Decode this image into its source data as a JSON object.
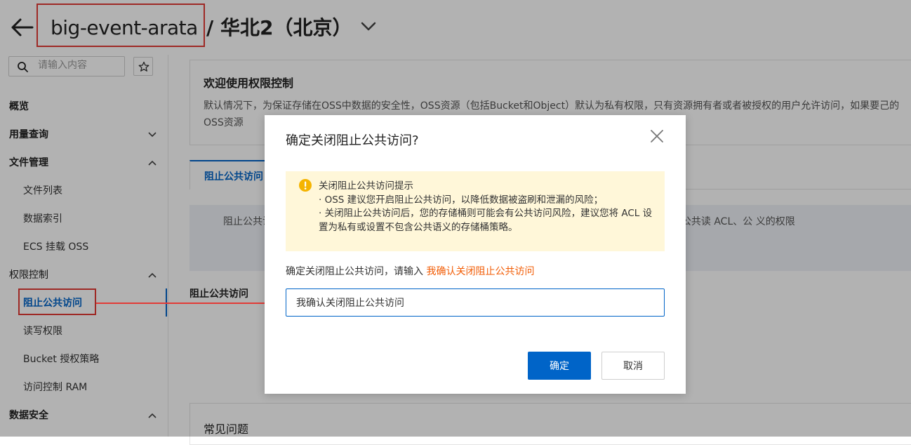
{
  "header": {
    "bucket_name": "big-event-arata",
    "region": "/ 华北2（北京）"
  },
  "sidebar": {
    "search_placeholder": "请输入内容",
    "groups": {
      "overview": "概览",
      "usage": "用量查询",
      "files": "文件管理",
      "access": "权限控制",
      "data_security": "数据安全"
    },
    "items": {
      "file_list": "文件列表",
      "data_index": "数据索引",
      "ecs_mount": "ECS 挂载 OSS",
      "block_public": "阻止公共访问",
      "rw_perm": "读写权限",
      "bucket_policy": "Bucket 授权策略",
      "ram": "访问控制 RAM"
    }
  },
  "main": {
    "welcome_title": "欢迎使用权限控制",
    "welcome_desc": "默认情况下，为保证存储在OSS中数据的安全性，OSS资源（包括Bucket和Object）默认为私有权限，只有资源拥有者或者被授权的用户允许访问，如果要己的OSS资源",
    "tab_label": "阻止公共访问",
    "info_text": "阻止公共访问 降低数据泄漏风险。开启阻止公共访问后，将不再有公共访问 权限策略将被忽略，创建新的公共读 ACL、公 义的权限",
    "section_label": "阻止公共访问",
    "faq_title": "常见问题"
  },
  "modal": {
    "title": "确定关闭阻止公共访问?",
    "warn_title": "关闭阻止公共访问提示",
    "warn_line1": "· OSS 建议您开启阻止公共访问，以降低数据被盗刷和泄漏的风险；",
    "warn_line2": "· 关闭阻止公共访问后，您的存储桶则可能会有公共访问风险，建议您将 ACL 设置为私有或设置不包含公共语义的存储桶策略。",
    "prompt": "确定关闭阻止公共访问，请输入 ",
    "phrase": "我确认关闭阻止公共访问",
    "input_value": "我确认关闭阻止公共访问",
    "ok_label": "确定",
    "cancel_label": "取消"
  },
  "colors": {
    "accent": "#0064c8",
    "annotation": "#e23b36",
    "warn_bg": "#fff7d9",
    "phrase": "#f25c05"
  }
}
